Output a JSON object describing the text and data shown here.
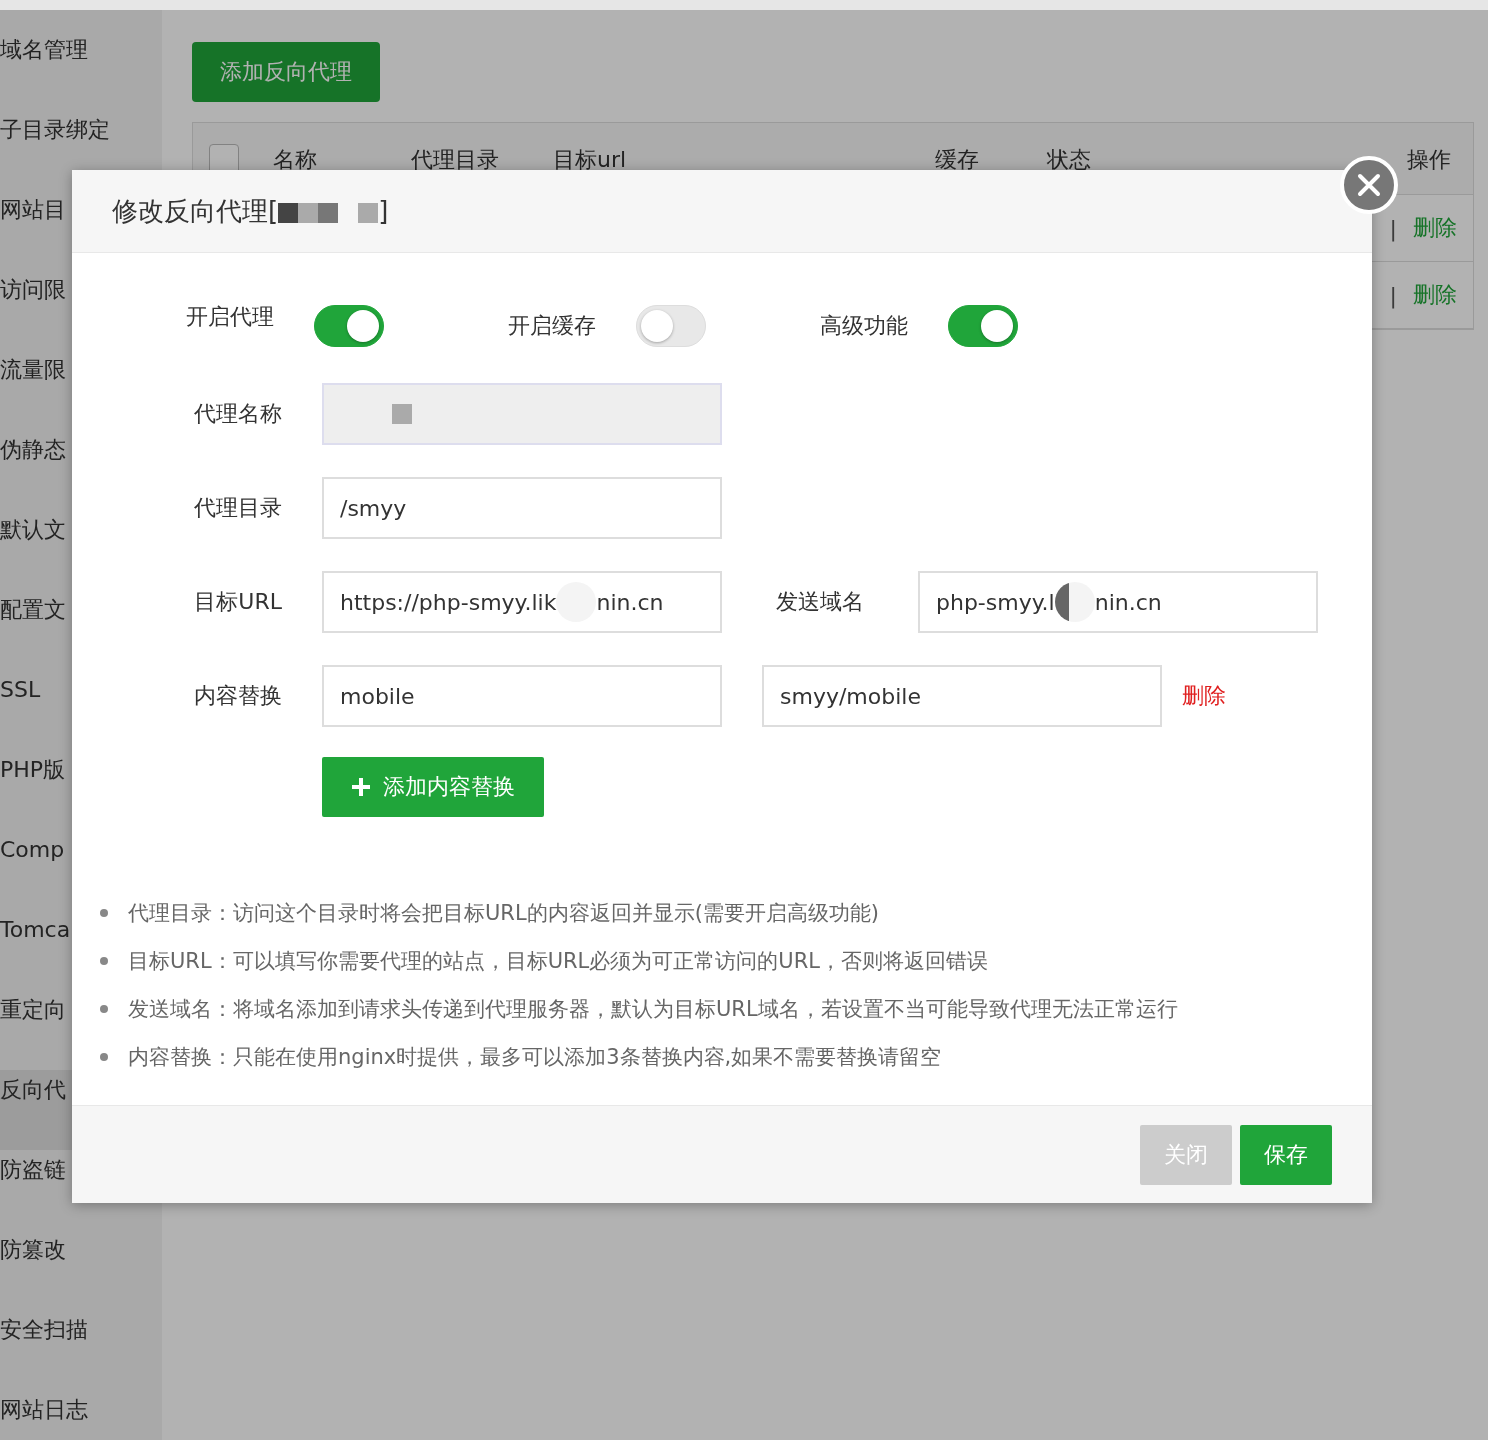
{
  "sidebar": {
    "items": [
      {
        "label": "域名管理",
        "selected": false
      },
      {
        "label": "子目录绑定",
        "selected": false
      },
      {
        "label": "网站目",
        "selected": false
      },
      {
        "label": "访问限",
        "selected": false
      },
      {
        "label": "流量限",
        "selected": false
      },
      {
        "label": "伪静态",
        "selected": false
      },
      {
        "label": "默认文",
        "selected": false
      },
      {
        "label": "配置文",
        "selected": false
      },
      {
        "label": "SSL",
        "selected": false
      },
      {
        "label": "PHP版",
        "selected": false
      },
      {
        "label": "Comp",
        "selected": false
      },
      {
        "label": "Tomca",
        "selected": false
      },
      {
        "label": "重定向",
        "selected": false
      },
      {
        "label": "反向代",
        "selected": true
      },
      {
        "label": "防盗链",
        "selected": false
      },
      {
        "label": "防篡改",
        "selected": false
      },
      {
        "label": "安全扫描",
        "selected": false
      },
      {
        "label": "网站日志",
        "selected": false
      }
    ]
  },
  "add_button": "添加反向代理",
  "table": {
    "select_all_checked": false,
    "columns": [
      "名称",
      "代理目录",
      "目标url",
      "缓存",
      "状态",
      "操作"
    ],
    "rows": [
      {
        "separator": "|",
        "action": "删除"
      },
      {
        "separator": "|",
        "action": "删除"
      }
    ]
  },
  "dialog": {
    "title_start": "修改反向代理[",
    "title_end": "]",
    "toggles": [
      {
        "label": "开启代理",
        "on": true
      },
      {
        "label": "开启缓存",
        "on": false
      },
      {
        "label": "高级功能",
        "on": true
      }
    ],
    "fields": [
      {
        "kind": "disabled",
        "label": "代理名称"
      },
      {
        "kind": "text",
        "label": "代理目录",
        "value": "/smyy"
      },
      {
        "kind": "pair",
        "label": "目标URL",
        "value_start": "https://php-smyy.lik",
        "value_end": "nin.cn",
        "second_label": "发送域名",
        "second_start": "php-smyy.l",
        "second_end": "nin.cn"
      },
      {
        "kind": "replace",
        "label": "内容替换",
        "value": "mobile",
        "second_value": "smyy/mobile",
        "delete": "删除"
      }
    ],
    "add_replace_button": "添加内容替换",
    "notes": [
      "代理目录：访问这个目录时将会把目标URL的内容返回并显示(需要开启高级功能)",
      "目标URL：可以填写你需要代理的站点，目标URL必须为可正常访问的URL，否则将返回错误",
      "发送域名：将域名添加到请求头传递到代理服务器，默认为目标URL域名，若设置不当可能导致代理无法正常运行",
      "内容替换：只能在使用nginx时提供，最多可以添加3条替换内容,如果不需要替换请留空"
    ],
    "buttons": [
      {
        "kind": "close",
        "label": "关闭"
      },
      {
        "kind": "save",
        "label": "保存"
      }
    ]
  }
}
